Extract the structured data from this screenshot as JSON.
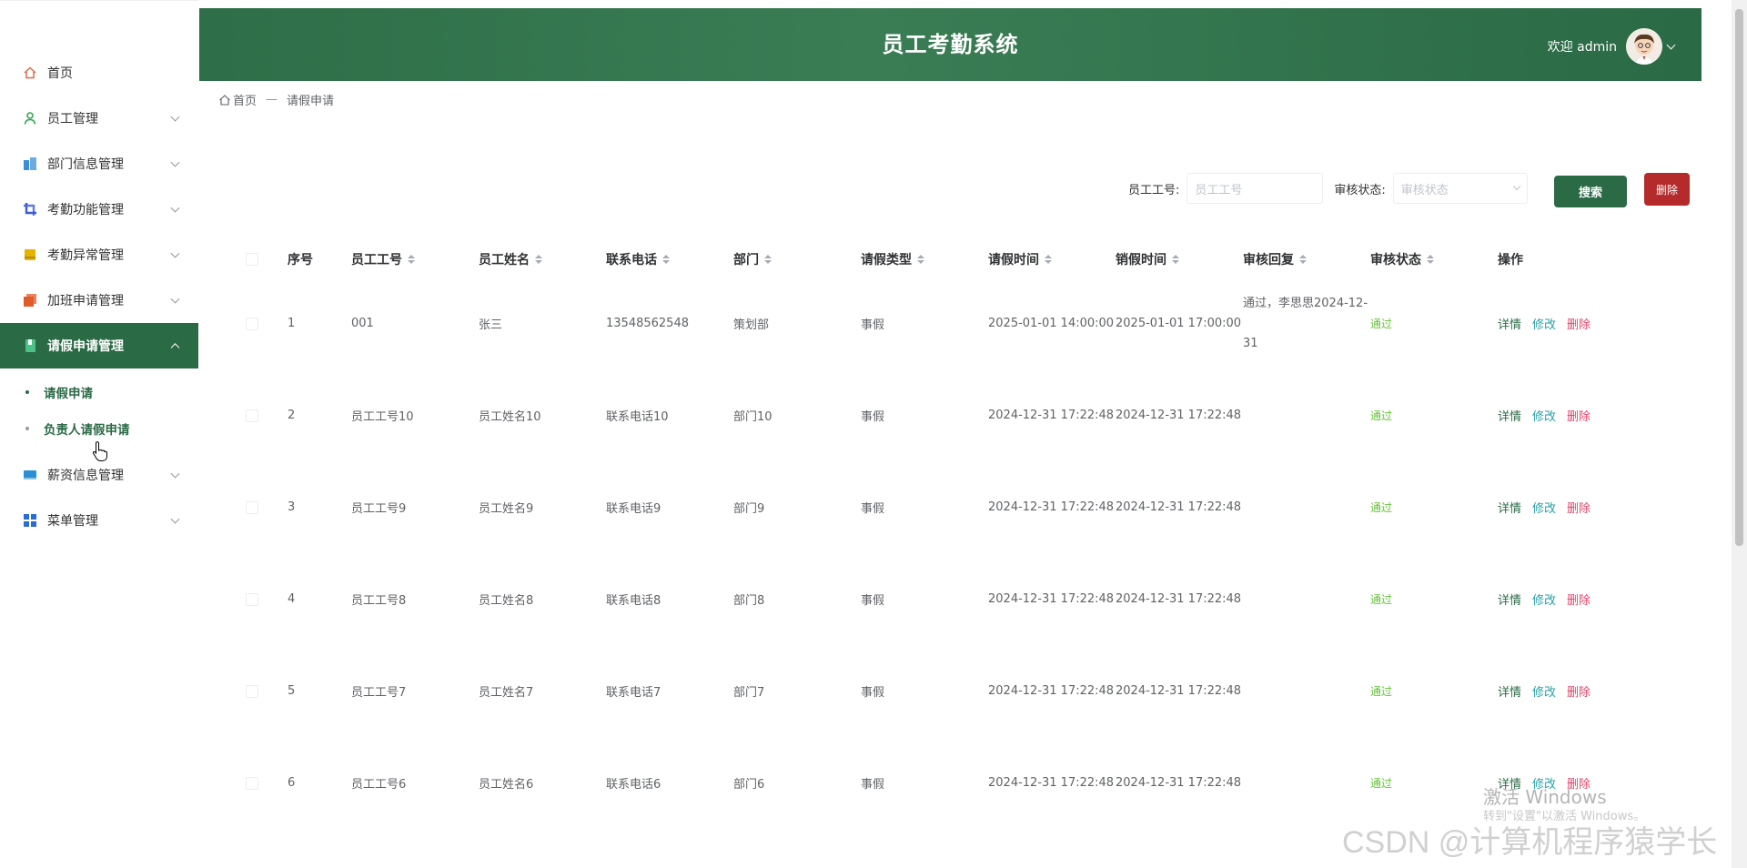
{
  "header": {
    "title": "员工考勤系统",
    "welcome": "欢迎 admin"
  },
  "sidebar": {
    "items": [
      {
        "label": "首页",
        "icon": "home-icon",
        "color": "#e06a4a",
        "has_children": false
      },
      {
        "label": "员工管理",
        "icon": "user-icon",
        "color": "#34a853",
        "has_children": true
      },
      {
        "label": "部门信息管理",
        "icon": "building-icon",
        "color": "#3b8fd6",
        "has_children": true
      },
      {
        "label": "考勤功能管理",
        "icon": "crop-icon",
        "color": "#3b5bd6",
        "has_children": true
      },
      {
        "label": "考勤异常管理",
        "icon": "card-icon",
        "color": "#e6b400",
        "has_children": true
      },
      {
        "label": "加班申请管理",
        "icon": "copy-icon",
        "color": "#e05a2a",
        "has_children": true
      },
      {
        "label": "请假申请管理",
        "icon": "book-icon",
        "color": "#ffffff",
        "has_children": true,
        "active": true
      },
      {
        "label": "薪资信息管理",
        "icon": "wallet-icon",
        "color": "#2b8fd6",
        "has_children": true
      },
      {
        "label": "菜单管理",
        "icon": "grid-icon",
        "color": "#2b6bd6",
        "has_children": true
      }
    ],
    "submenu": [
      "请假申请",
      "负责人请假申请"
    ]
  },
  "breadcrumb": {
    "home": "首页",
    "separator": "—",
    "current": "请假申请"
  },
  "search": {
    "emp_no_label": "员工工号:",
    "emp_no_placeholder": "员工工号",
    "status_label": "审核状态:",
    "status_placeholder": "审核状态",
    "search_button": "搜索",
    "delete_button": "删除"
  },
  "table": {
    "columns": [
      "序号",
      "员工工号",
      "员工姓名",
      "联系电话",
      "部门",
      "请假类型",
      "请假时间",
      "销假时间",
      "审核回复",
      "审核状态",
      "操作"
    ],
    "rows": [
      {
        "no": "1",
        "emp_no": "001",
        "name": "张三",
        "phone": "13548562548",
        "dept": "策划部",
        "type": "事假",
        "leave_time": "2025-01-01 14:00:00",
        "return_time": "2025-01-01 17:00:00",
        "reply": "通过，李思思2024-12-31",
        "status": "通过"
      },
      {
        "no": "2",
        "emp_no": "员工工号10",
        "name": "员工姓名10",
        "phone": "联系电话10",
        "dept": "部门10",
        "type": "事假",
        "leave_time": "2024-12-31 17:22:48",
        "return_time": "2024-12-31 17:22:48",
        "reply": "",
        "status": "通过"
      },
      {
        "no": "3",
        "emp_no": "员工工号9",
        "name": "员工姓名9",
        "phone": "联系电话9",
        "dept": "部门9",
        "type": "事假",
        "leave_time": "2024-12-31 17:22:48",
        "return_time": "2024-12-31 17:22:48",
        "reply": "",
        "status": "通过"
      },
      {
        "no": "4",
        "emp_no": "员工工号8",
        "name": "员工姓名8",
        "phone": "联系电话8",
        "dept": "部门8",
        "type": "事假",
        "leave_time": "2024-12-31 17:22:48",
        "return_time": "2024-12-31 17:22:48",
        "reply": "",
        "status": "通过"
      },
      {
        "no": "5",
        "emp_no": "员工工号7",
        "name": "员工姓名7",
        "phone": "联系电话7",
        "dept": "部门7",
        "type": "事假",
        "leave_time": "2024-12-31 17:22:48",
        "return_time": "2024-12-31 17:22:48",
        "reply": "",
        "status": "通过"
      },
      {
        "no": "6",
        "emp_no": "员工工号6",
        "name": "员工姓名6",
        "phone": "联系电话6",
        "dept": "部门6",
        "type": "事假",
        "leave_time": "2024-12-31 17:22:48",
        "return_time": "2024-12-31 17:22:48",
        "reply": "",
        "status": "通过"
      }
    ],
    "actions": {
      "detail": "详情",
      "edit": "修改",
      "delete": "删除"
    }
  },
  "watermark": {
    "windows_title": "激活 Windows",
    "windows_sub": "转到\"设置\"以激活 Windows。",
    "csdn": "CSDN @计算机程序猿学长"
  }
}
